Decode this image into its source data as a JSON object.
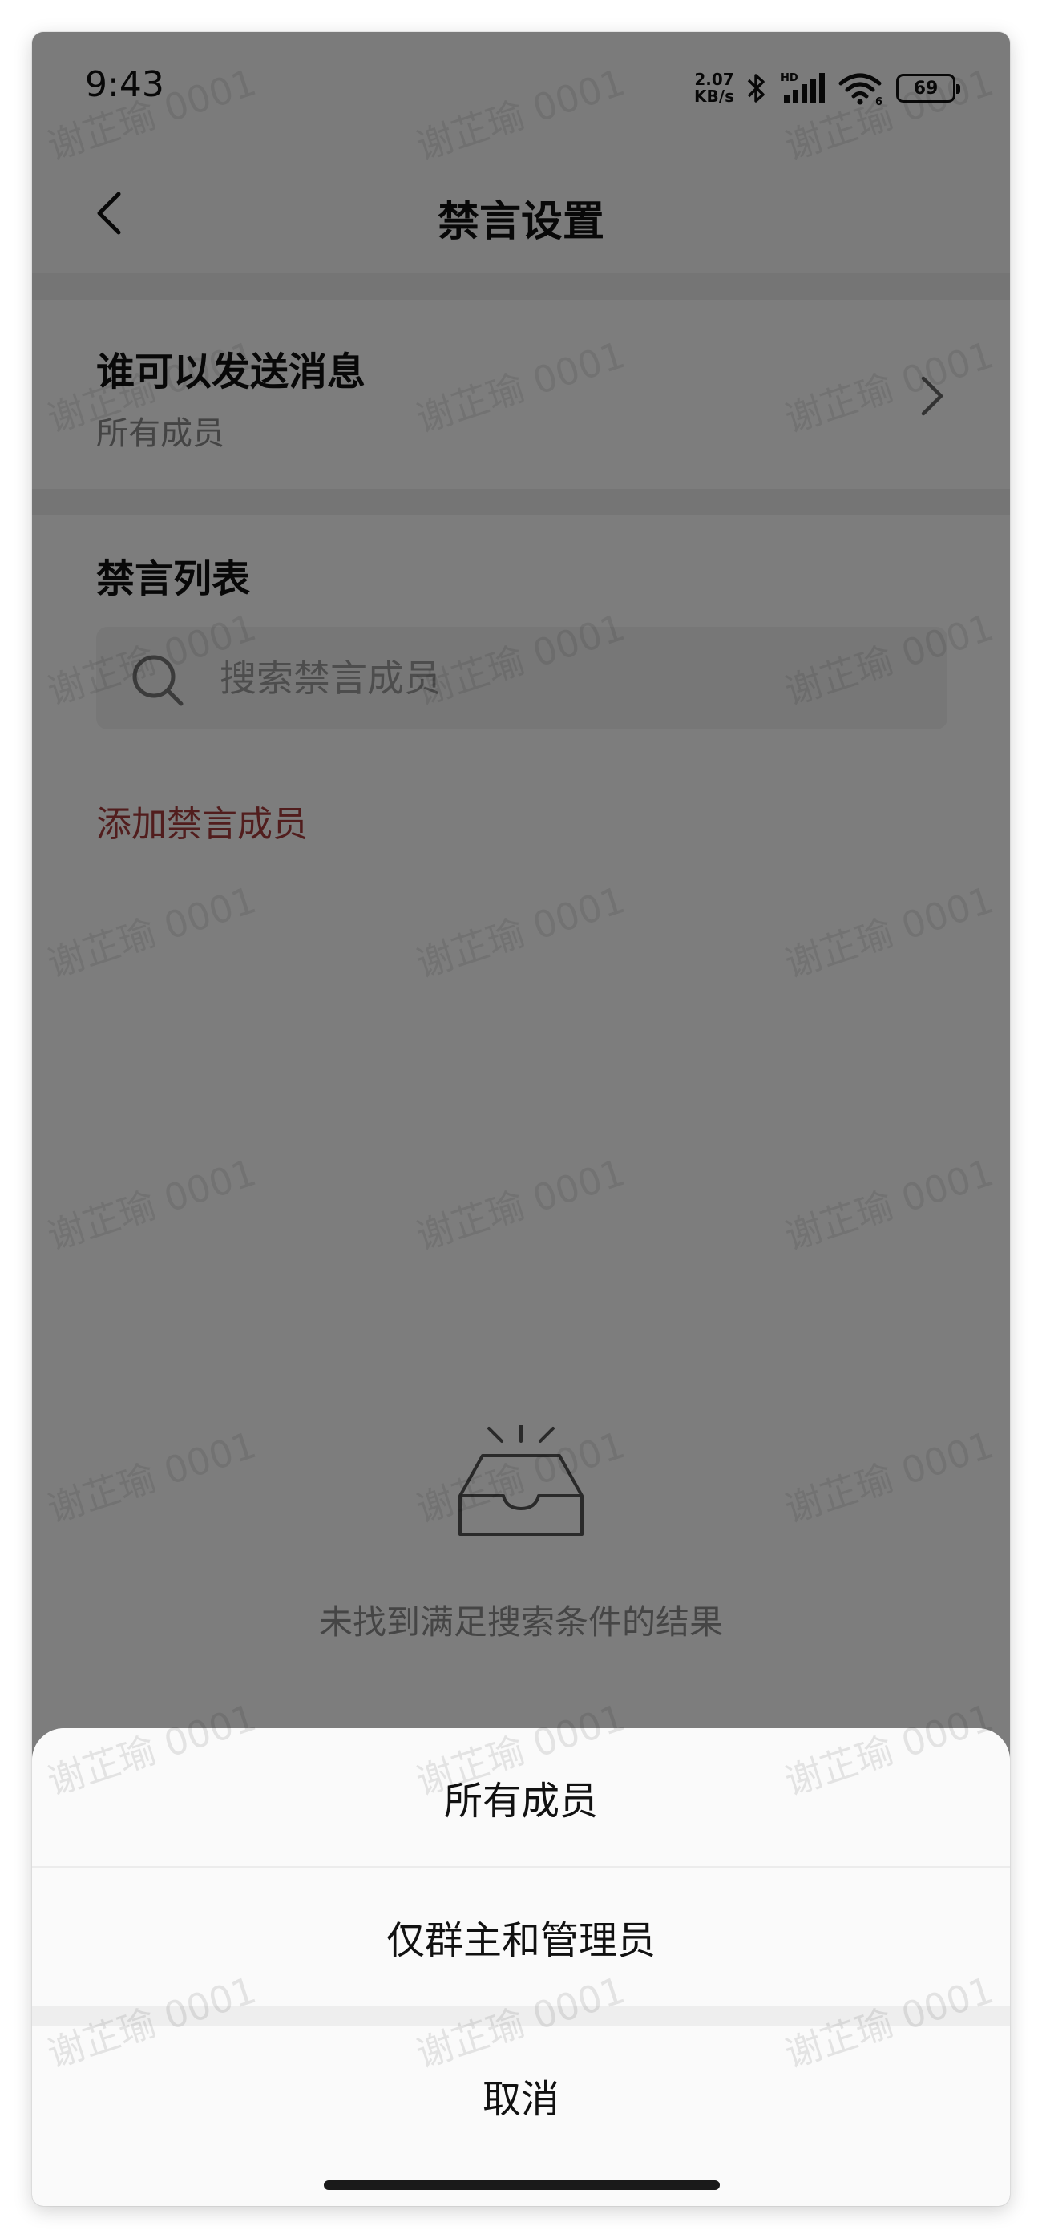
{
  "status_bar": {
    "time": "9:43",
    "net_speed_value": "2.07",
    "net_speed_unit": "KB/s",
    "signal_label": "HD",
    "wifi_label": "6",
    "battery": "69"
  },
  "header": {
    "title": "禁言设置"
  },
  "send_permission": {
    "title": "谁可以发送消息",
    "value": "所有成员"
  },
  "mute_list": {
    "title": "禁言列表",
    "search_placeholder": "搜索禁言成员",
    "add_label": "添加禁言成员",
    "empty_text": "未找到满足搜索条件的结果"
  },
  "watermark": "谢芷瑜 0001",
  "action_sheet": {
    "options": [
      "所有成员",
      "仅群主和管理员"
    ],
    "cancel_label": "取消"
  },
  "colors": {
    "accent": "#a33a3a",
    "overlay": "#000000"
  }
}
